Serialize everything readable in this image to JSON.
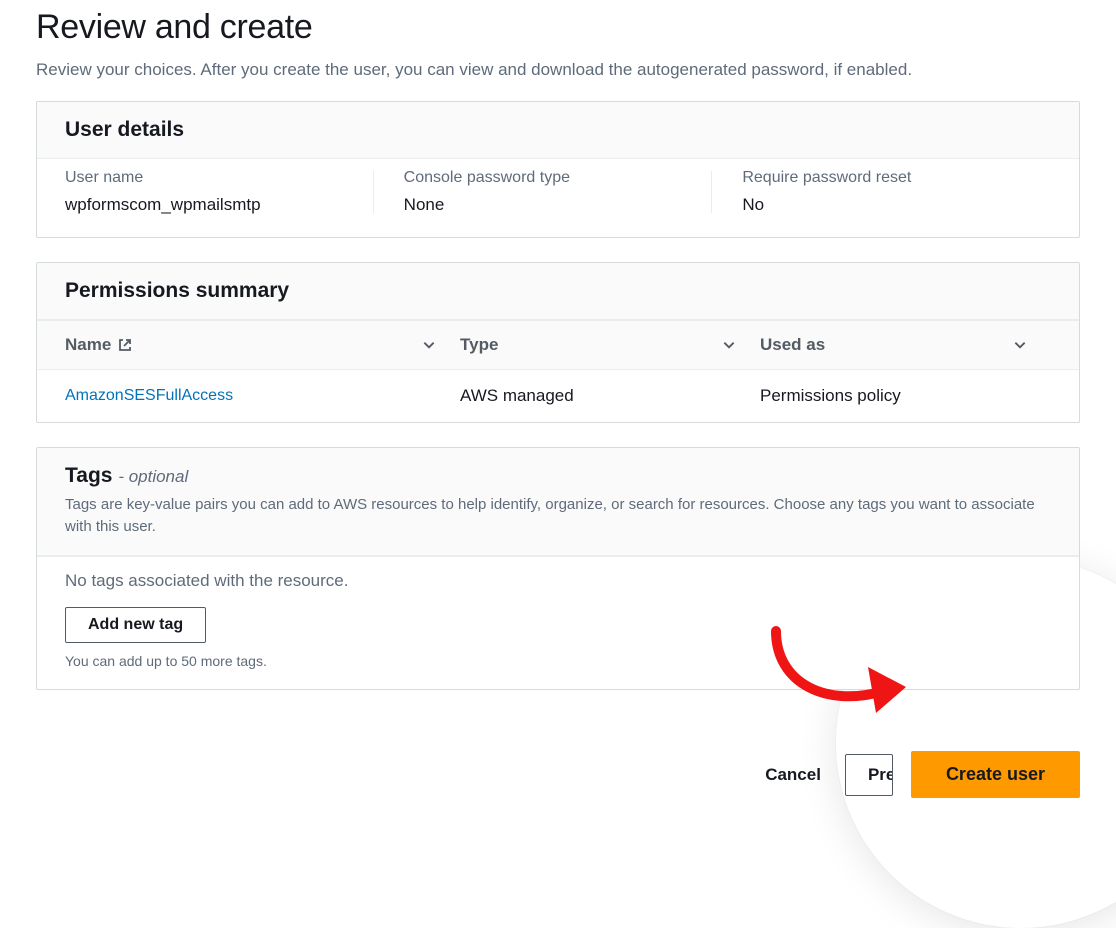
{
  "header": {
    "title": "Review and create",
    "description": "Review your choices. After you create the user, you can view and download the autogenerated password, if enabled."
  },
  "user_details": {
    "panel_title": "User details",
    "fields": {
      "user_name": {
        "label": "User name",
        "value": "wpformscom_wpmailsmtp"
      },
      "console_password_type": {
        "label": "Console password type",
        "value": "None"
      },
      "require_password_reset": {
        "label": "Require password reset",
        "value": "No"
      }
    }
  },
  "permissions": {
    "panel_title": "Permissions summary",
    "columns": {
      "name": "Name",
      "type": "Type",
      "used_as": "Used as"
    },
    "rows": [
      {
        "name": "AmazonSESFullAccess",
        "type": "AWS managed",
        "used_as": "Permissions policy"
      }
    ]
  },
  "tags": {
    "panel_title": "Tags",
    "optional_suffix": "- optional",
    "description": "Tags are key-value pairs you can add to AWS resources to help identify, organize, or search for resources. Choose any tags you want to associate with this user.",
    "empty_message": "No tags associated with the resource.",
    "add_button": "Add new tag",
    "limit_hint": "You can add up to 50 more tags."
  },
  "footer": {
    "cancel": "Cancel",
    "previous": "Previous",
    "create": "Create user"
  }
}
